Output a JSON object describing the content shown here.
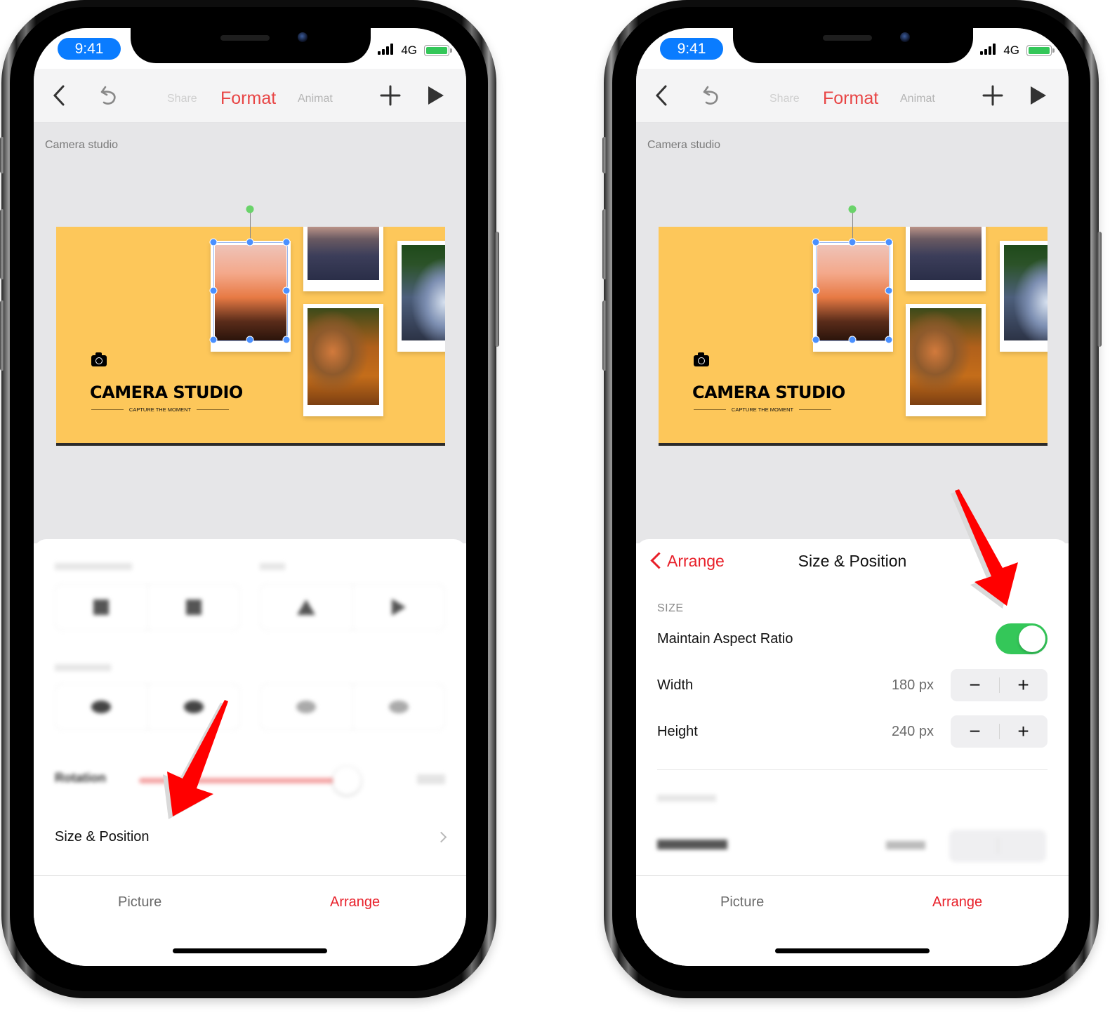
{
  "status_bar": {
    "time": "9:41",
    "network": "4G"
  },
  "toolbar": {
    "tabs": {
      "share": "Share",
      "format": "Format",
      "animate": "Animat"
    },
    "accent": "#e84545"
  },
  "document": {
    "title": "Camera studio"
  },
  "slide": {
    "title": "CAMERA STUDIO",
    "subtitle": "CAPTURE THE MOMENT",
    "background": "#fdc75a"
  },
  "left_phone": {
    "panel": {
      "rotation_label": "Rotation",
      "size_position_label": "Size & Position"
    }
  },
  "right_phone": {
    "panel": {
      "back_label": "Arrange",
      "title": "Size & Position",
      "section_size": "SIZE",
      "maintain_aspect_label": "Maintain Aspect Ratio",
      "maintain_aspect_on": true,
      "width_label": "Width",
      "width_value": "180 px",
      "height_label": "Height",
      "height_value": "240 px",
      "minus": "−",
      "plus": "+"
    }
  },
  "bottom_tabs": {
    "picture": "Picture",
    "arrange": "Arrange",
    "active": "Arrange"
  },
  "colors": {
    "active_red": "#e8202a",
    "toggle_green": "#34c759",
    "selection_blue": "#4a90ff"
  }
}
